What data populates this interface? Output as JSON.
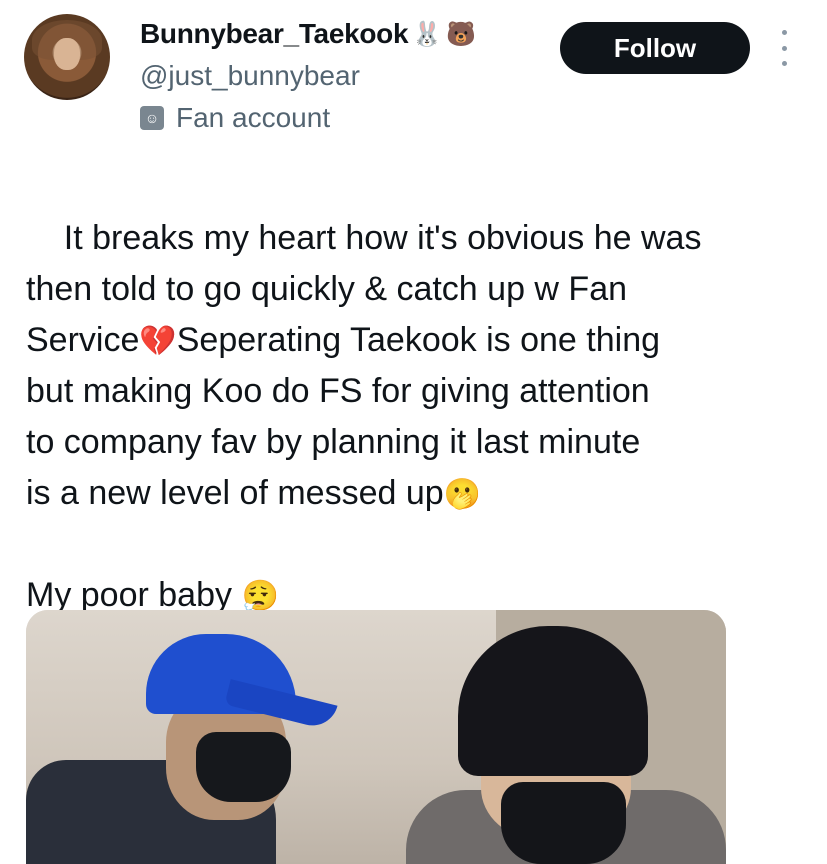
{
  "author": {
    "display_name": "Bunnybear_Taekook",
    "name_emojis": [
      "🐰",
      "🐻"
    ],
    "handle": "@just_bunnybear",
    "label": "Fan account",
    "label_icon": "theater-masks-icon"
  },
  "actions": {
    "follow_label": "Follow",
    "more_icon": "more-options-icon"
  },
  "tweet": {
    "segments": [
      {
        "text": "It breaks my heart how it's obvious he was\nthen told to go quickly & catch up w Fan\nService"
      },
      {
        "emoji": "💔"
      },
      {
        "text": "Seperating Taekook is one thing\nbut making Koo do FS for giving attention\nto company fav by planning it last minute\nis a new level of messed up"
      },
      {
        "emoji": "🫢"
      },
      {
        "text": "\n\nMy poor baby "
      },
      {
        "emoji": "😮‍💨"
      }
    ]
  },
  "colors": {
    "text_primary": "#0f1419",
    "text_secondary": "#536471",
    "follow_bg": "#0f1419",
    "cap_blue": "#1f4fcf"
  }
}
